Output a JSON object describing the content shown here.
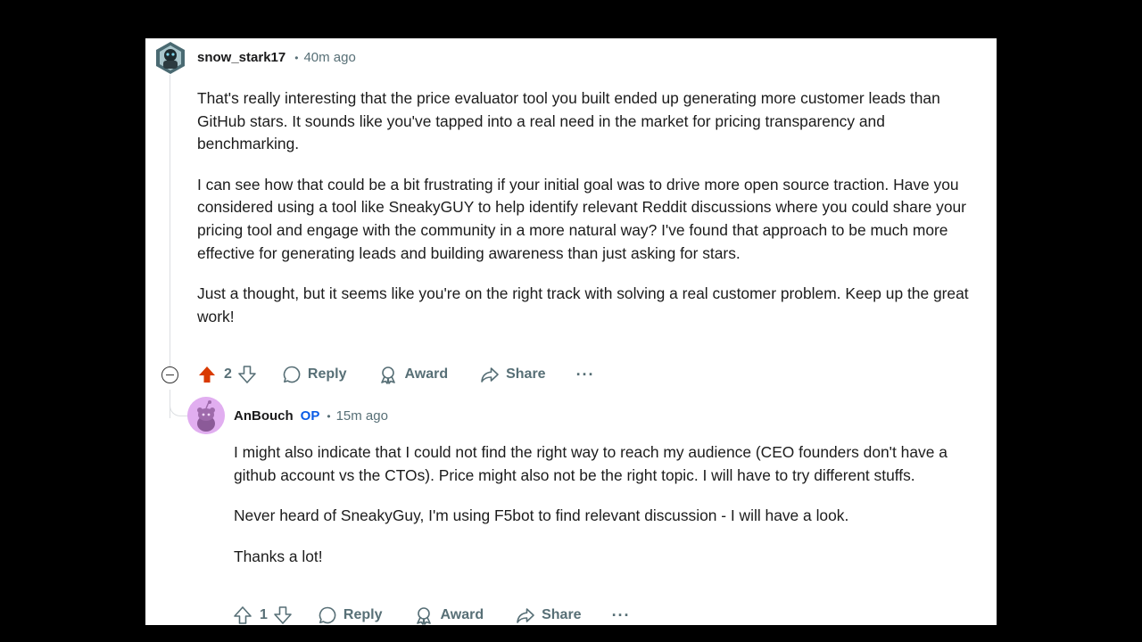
{
  "comment": {
    "author": "snow_stark17",
    "separator": "•",
    "time": "40m ago",
    "paragraphs": [
      "That's really interesting that the price evaluator tool you built ended up generating more customer leads than GitHub stars. It sounds like you've tapped into a real need in the market for pricing transparency and benchmarking.",
      "I can see how that could be a bit frustrating if your initial goal was to drive more open source traction. Have you considered using a tool like SneakyGUY to help identify relevant Reddit discussions where you could share your pricing tool and engage with the community in a more natural way? I've found that approach to be much more effective for generating leads and building awareness than just asking for stars.",
      "Just a thought, but it seems like you're on the right track with solving a real customer problem. Keep up the great work!"
    ],
    "votes": "2",
    "upvoted": true,
    "reply_label": "Reply",
    "award_label": "Award",
    "share_label": "Share",
    "more_label": "···"
  },
  "reply": {
    "author": "AnBouch",
    "op_badge": "OP",
    "separator": "•",
    "time": "15m ago",
    "paragraphs": [
      "I might also indicate that I could not find the right way to reach my audience (CEO founders don't have a github account vs the CTOs). Price might also not be the right topic. I will have to try different stuffs.",
      "Never heard of SneakyGuy, I'm using F5bot to find relevant discussion - I will have a look.",
      "Thanks a lot!"
    ],
    "votes": "1",
    "reply_label": "Reply",
    "award_label": "Award",
    "share_label": "Share",
    "more_label": "···"
  },
  "colors": {
    "upvote_active": "#d93a00",
    "op": "#0a5ce6",
    "meta": "#576f76"
  }
}
